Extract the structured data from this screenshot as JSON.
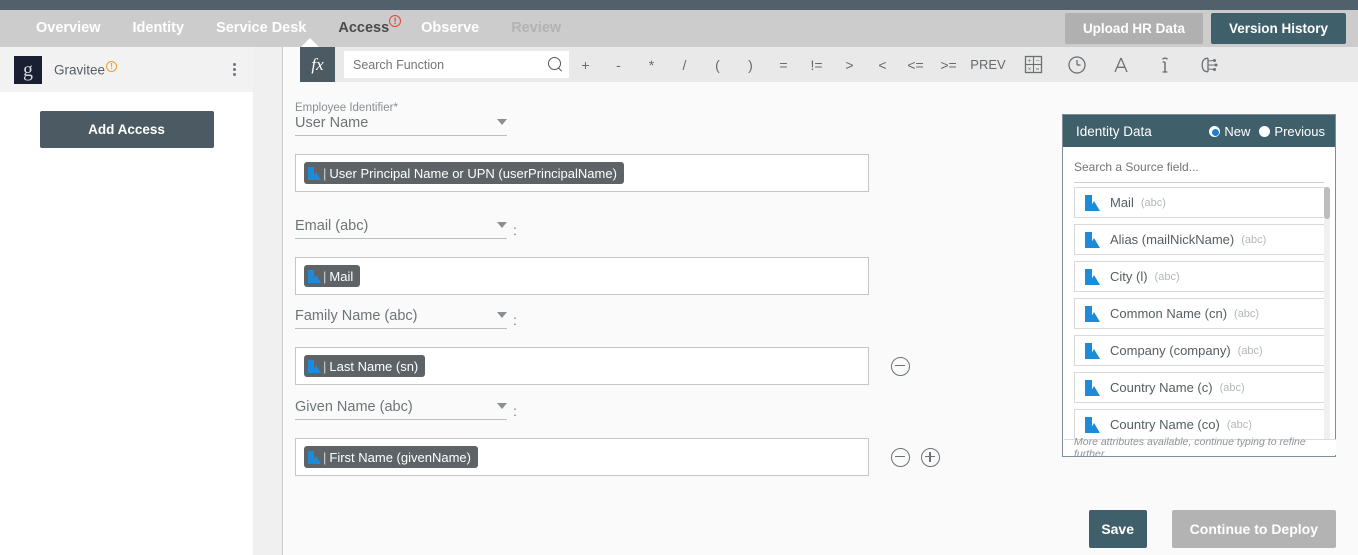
{
  "nav": {
    "items": [
      {
        "label": "Overview",
        "state": "normal"
      },
      {
        "label": "Identity",
        "state": "normal"
      },
      {
        "label": "Service Desk",
        "state": "normal"
      },
      {
        "label": "Access",
        "state": "active",
        "badge": "!"
      },
      {
        "label": "Observe",
        "state": "normal"
      },
      {
        "label": "Review",
        "state": "dim"
      }
    ],
    "upload_label": "Upload HR Data",
    "version_label": "Version History"
  },
  "sidebar": {
    "app_name": "Gravitee",
    "app_logo_glyph": "g",
    "warning_glyph": "!",
    "add_access_label": "Add Access"
  },
  "toolbar": {
    "fx_label": "fx",
    "search_placeholder": "Search Function",
    "operators": [
      "+",
      "-",
      "*",
      "/",
      "(",
      ")",
      "=",
      "!=",
      ">",
      "<",
      "<=",
      ">=",
      "PREV"
    ],
    "icons": [
      "calculator-icon",
      "clock-icon",
      "text-icon",
      "info-icon",
      "ai-icon"
    ]
  },
  "form": {
    "rows": [
      {
        "label": "Employee Identifier*",
        "select_value": "User Name",
        "has_colon": false,
        "token": "User Principal Name or UPN (userPrincipalName)",
        "controls": []
      },
      {
        "label": "",
        "select_value": "Email (abc)",
        "has_colon": true,
        "token": "Mail",
        "controls": []
      },
      {
        "label": "",
        "select_value": "Family Name (abc)",
        "has_colon": true,
        "token": "Last Name (sn)",
        "controls": [
          "minus"
        ]
      },
      {
        "label": "",
        "select_value": "Given Name (abc)",
        "has_colon": true,
        "token": "First Name (givenName)",
        "controls": [
          "minus",
          "plus"
        ]
      }
    ]
  },
  "identity_panel": {
    "title": "Identity Data",
    "radio_new": "New",
    "radio_previous": "Previous",
    "selected_radio": "New",
    "search_placeholder": "Search a Source field...",
    "items": [
      {
        "name": "Mail",
        "type": "(abc)"
      },
      {
        "name": "Alias (mailNickName)",
        "type": "(abc)"
      },
      {
        "name": "City (l)",
        "type": "(abc)"
      },
      {
        "name": "Common Name (cn)",
        "type": "(abc)"
      },
      {
        "name": "Company (company)",
        "type": "(abc)"
      },
      {
        "name": "Country Name (c)",
        "type": "(abc)"
      },
      {
        "name": "Country Name (co)",
        "type": "(abc)"
      }
    ],
    "footer": "More attributes available, continue typing to refine further."
  },
  "footer_actions": {
    "save_label": "Save",
    "deploy_label": "Continue to Deploy"
  },
  "colors": {
    "accent_dark": "#3f5f6b",
    "nav_bg": "#cccccc",
    "token_bg": "#5d6366",
    "icon_blue": "#1e8bd8",
    "warning": "#f0a028",
    "error": "#e8433f"
  }
}
